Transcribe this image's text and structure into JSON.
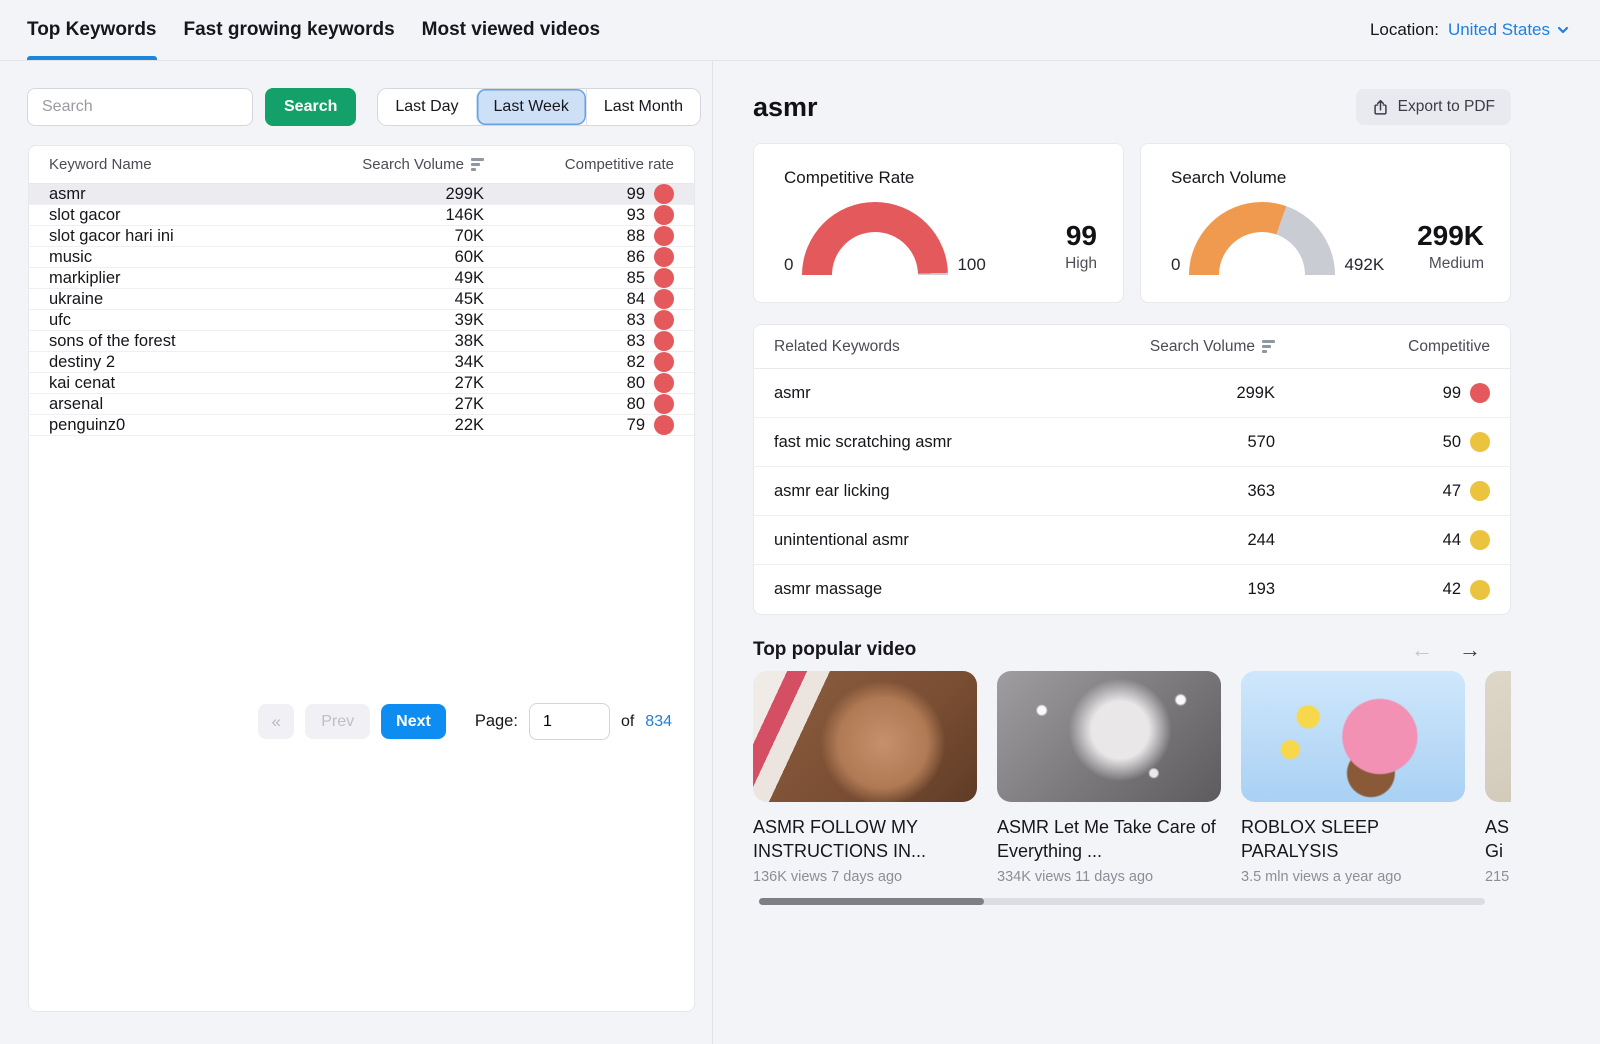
{
  "header": {
    "tabs": [
      {
        "label": "Top Keywords",
        "active": true
      },
      {
        "label": "Fast growing keywords",
        "active": false
      },
      {
        "label": "Most viewed videos",
        "active": false
      }
    ],
    "location": {
      "label": "Location:",
      "value": "United States"
    }
  },
  "left_panel": {
    "search": {
      "placeholder": "Search",
      "button": "Search"
    },
    "time_filters": [
      {
        "label": "Last Day",
        "selected": false
      },
      {
        "label": "Last Week",
        "selected": true
      },
      {
        "label": "Last Month",
        "selected": false
      }
    ],
    "table": {
      "columns": {
        "keyword": "Keyword Name",
        "volume": "Search Volume",
        "rate": "Competitive rate"
      },
      "rows": [
        {
          "keyword": "asmr",
          "volume": "299K",
          "rate": "99",
          "dot": "red",
          "selected": true
        },
        {
          "keyword": "slot gacor",
          "volume": "146K",
          "rate": "93",
          "dot": "red",
          "selected": false
        },
        {
          "keyword": "slot gacor hari ini",
          "volume": "70K",
          "rate": "88",
          "dot": "red",
          "selected": false
        },
        {
          "keyword": "music",
          "volume": "60K",
          "rate": "86",
          "dot": "red",
          "selected": false
        },
        {
          "keyword": "markiplier",
          "volume": "49K",
          "rate": "85",
          "dot": "red",
          "selected": false
        },
        {
          "keyword": "ukraine",
          "volume": "45K",
          "rate": "84",
          "dot": "red",
          "selected": false
        },
        {
          "keyword": "ufc",
          "volume": "39K",
          "rate": "83",
          "dot": "red",
          "selected": false
        },
        {
          "keyword": "sons of the forest",
          "volume": "38K",
          "rate": "83",
          "dot": "red",
          "selected": false
        },
        {
          "keyword": "destiny 2",
          "volume": "34K",
          "rate": "82",
          "dot": "red",
          "selected": false
        },
        {
          "keyword": "kai cenat",
          "volume": "27K",
          "rate": "80",
          "dot": "red",
          "selected": false
        },
        {
          "keyword": "arsenal",
          "volume": "27K",
          "rate": "80",
          "dot": "red",
          "selected": false
        },
        {
          "keyword": "penguinz0",
          "volume": "22K",
          "rate": "79",
          "dot": "red",
          "selected": false
        }
      ]
    },
    "pagination": {
      "first": "«",
      "prev": "Prev",
      "next": "Next",
      "page_label": "Page:",
      "page_value": "1",
      "of_label": "of",
      "total": "834"
    }
  },
  "detail_panel": {
    "title": "asmr",
    "export_button": "Export to PDF",
    "gauges": [
      {
        "title": "Competitive Rate",
        "min_label": "0",
        "max_label": "100",
        "value": 99,
        "max": 100,
        "value_label": "99",
        "level": "High",
        "color": "#e4595c"
      },
      {
        "title": "Search Volume",
        "min_label": "0",
        "max_label": "492K",
        "value": 299,
        "max": 492,
        "value_label": "299K",
        "level": "Medium",
        "color": "#ef9a4e"
      }
    ],
    "related": {
      "columns": {
        "keyword": "Related Keywords",
        "volume": "Search Volume",
        "rate": "Competitive"
      },
      "rows": [
        {
          "keyword": "asmr",
          "volume": "299K",
          "rate": "99",
          "dot": "red"
        },
        {
          "keyword": "fast mic scratching asmr",
          "volume": "570",
          "rate": "50",
          "dot": "yellow"
        },
        {
          "keyword": "asmr ear licking",
          "volume": "363",
          "rate": "47",
          "dot": "yellow"
        },
        {
          "keyword": "unintentional asmr",
          "volume": "244",
          "rate": "44",
          "dot": "yellow"
        },
        {
          "keyword": "asmr massage",
          "volume": "193",
          "rate": "42",
          "dot": "yellow"
        }
      ]
    },
    "videos": {
      "heading": "Top popular video",
      "prev_arrow": "←",
      "next_arrow": "→",
      "items": [
        {
          "title": "ASMR FOLLOW MY INSTRUCTIONS IN...",
          "views": "136K views 7 days ago",
          "thumb": "warm"
        },
        {
          "title": "ASMR Let Me Take Care of Everything ...",
          "views": "334K views 11 days ago",
          "thumb": "silver"
        },
        {
          "title": "ROBLOX SLEEP PARALYSIS",
          "views": "3.5 mln views a year ago",
          "thumb": "cartoon"
        },
        {
          "title": "AS\nGi",
          "views": "215",
          "thumb": "beige"
        }
      ]
    }
  },
  "colors": {
    "accent_blue": "#1c86dd",
    "button_blue": "#0d8df2",
    "button_green": "#13a169",
    "gauge_remainder": "#c9ccd3",
    "dots": {
      "red": "#e4595c",
      "yellow": "#ebc33e"
    }
  }
}
